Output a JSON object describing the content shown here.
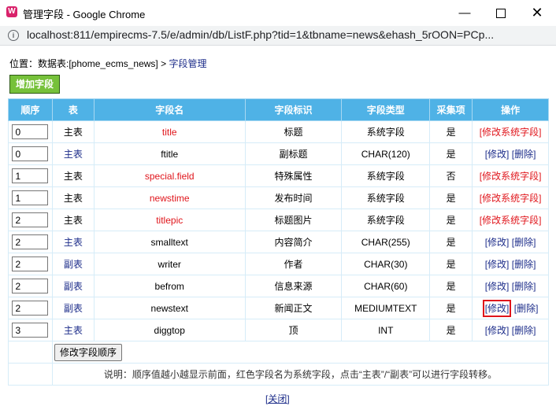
{
  "window": {
    "title": "管理字段 - Google Chrome",
    "app_icon_glyph": "W",
    "minimize": "—",
    "close": "✕"
  },
  "address": {
    "url": "localhost:811/empirecms-7.5/e/admin/db/ListF.php?tid=1&tbname=news&ehash_5rOON=PCp...",
    "info_glyph": "i"
  },
  "breadcrumb": {
    "prefix": "位置：",
    "table_link": "数据表:[phome_ecms_news]",
    "separator": " > ",
    "page_link": "字段管理"
  },
  "add_field_button": "增加字段",
  "table": {
    "headers": [
      "顺序",
      "表",
      "字段名",
      "字段标识",
      "字段类型",
      "采集项",
      "操作"
    ],
    "rows": [
      {
        "order": "0",
        "table": "主表",
        "table_link": false,
        "name": "title",
        "system": true,
        "label": "标题",
        "type": "系统字段",
        "collect": "是",
        "ops": [
          "[修改系统字段]"
        ]
      },
      {
        "order": "0",
        "table": "主表",
        "table_link": true,
        "name": "ftitle",
        "system": false,
        "label": "副标题",
        "type": "CHAR(120)",
        "collect": "是",
        "ops": [
          "[修改]",
          "[删除]"
        ]
      },
      {
        "order": "1",
        "table": "主表",
        "table_link": false,
        "name": "special.field",
        "system": true,
        "label": "特殊属性",
        "type": "系统字段",
        "collect": "否",
        "ops": [
          "[修改系统字段]"
        ]
      },
      {
        "order": "1",
        "table": "主表",
        "table_link": false,
        "name": "newstime",
        "system": true,
        "label": "发布时间",
        "type": "系统字段",
        "collect": "是",
        "ops": [
          "[修改系统字段]"
        ]
      },
      {
        "order": "2",
        "table": "主表",
        "table_link": false,
        "name": "titlepic",
        "system": true,
        "label": "标题图片",
        "type": "系统字段",
        "collect": "是",
        "ops": [
          "[修改系统字段]"
        ]
      },
      {
        "order": "2",
        "table": "主表",
        "table_link": true,
        "name": "smalltext",
        "system": false,
        "label": "内容简介",
        "type": "CHAR(255)",
        "collect": "是",
        "ops": [
          "[修改]",
          "[删除]"
        ]
      },
      {
        "order": "2",
        "table": "副表",
        "table_link": true,
        "name": "writer",
        "system": false,
        "label": "作者",
        "type": "CHAR(30)",
        "collect": "是",
        "ops": [
          "[修改]",
          "[删除]"
        ]
      },
      {
        "order": "2",
        "table": "副表",
        "table_link": true,
        "name": "befrom",
        "system": false,
        "label": "信息来源",
        "type": "CHAR(60)",
        "collect": "是",
        "ops": [
          "[修改]",
          "[删除]"
        ]
      },
      {
        "order": "2",
        "table": "副表",
        "table_link": true,
        "name": "newstext",
        "system": false,
        "label": "新闻正文",
        "type": "MEDIUMTEXT",
        "collect": "是",
        "ops": [
          "[修改]",
          "[删除]"
        ],
        "highlight_edit": true
      },
      {
        "order": "3",
        "table": "主表",
        "table_link": true,
        "name": "diggtop",
        "system": false,
        "label": "顶",
        "type": "INT",
        "collect": "是",
        "ops": [
          "[修改]",
          "[删除]"
        ]
      }
    ],
    "sort_button": "修改字段顺序",
    "note": "说明：顺序值越小越显示前面，红色字段名为系统字段，点击“主表”/“副表”可以进行字段转移。"
  },
  "close_link": "[关闭]",
  "colors": {
    "header_bg": "#4fb2e6",
    "add_button_bg": "#76c13a",
    "system_field_red": "#e0151b",
    "link_blue": "#1d2d8a"
  }
}
